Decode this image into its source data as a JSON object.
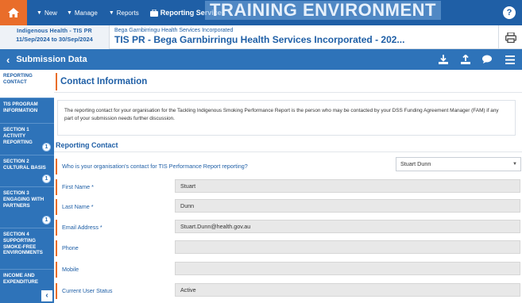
{
  "topnav": {
    "new_label": "New",
    "manage_label": "Manage",
    "reports_label": "Reports",
    "reporting_label": "Reporting Services",
    "watermark": "TRAINING ENVIRONMENT",
    "help": "?"
  },
  "context": {
    "program": "Indigenous Health - TIS PR",
    "period": "11/Sep/2024 to 30/Sep/2024",
    "org": "Bega Garnbirringu Health Services Incorporated",
    "title": "TIS PR - Bega Garnbirringu Health Services Incorporated - 202..."
  },
  "subbar": {
    "label": "Submission Data"
  },
  "sidebar": {
    "items": [
      {
        "label": "REPORTING CONTACT",
        "badge": ""
      },
      {
        "label": "TIS PROGRAM INFORMATION",
        "badge": ""
      },
      {
        "label": "SECTION 1 ACTIVITY REPORTING",
        "badge": "1"
      },
      {
        "label": "SECTION 2 CULTURAL BASIS",
        "badge": "1"
      },
      {
        "label": "SECTION 3 ENGAGING WITH PARTNERS",
        "badge": "1"
      },
      {
        "label": "SECTION 4 SUPPORTING SMOKE-FREE ENVIRONMENTS",
        "badge": ""
      },
      {
        "label": "INCOME AND EXPENDITURE",
        "badge": ""
      }
    ],
    "collapse": "‹"
  },
  "content": {
    "title": "Contact Information",
    "info": "The reporting contact for your organisation for the Tackling Indigenous Smoking Performance Report is the person who may be contacted by your DSS Funding Agreement Manager (FAM) if any part of your submission needs further discussion.",
    "reporting_contact_title": "Reporting Contact",
    "question": "Who is your organisation's contact for TIS Performance Report reporting?",
    "selected_contact": "Stuart Dunn",
    "fields": [
      {
        "label": "First Name *",
        "value": "Stuart"
      },
      {
        "label": "Last Name *",
        "value": "Dunn"
      },
      {
        "label": "Email Address *",
        "value": "Stuart.Dunn@health.gov.au"
      },
      {
        "label": "Phone",
        "value": ""
      },
      {
        "label": "Mobile",
        "value": ""
      },
      {
        "label": "Current User Status",
        "value": "Active"
      }
    ]
  },
  "colors": {
    "nav": "#1f5fa6",
    "bar": "#2e73b9",
    "accent": "#e96d2a"
  }
}
